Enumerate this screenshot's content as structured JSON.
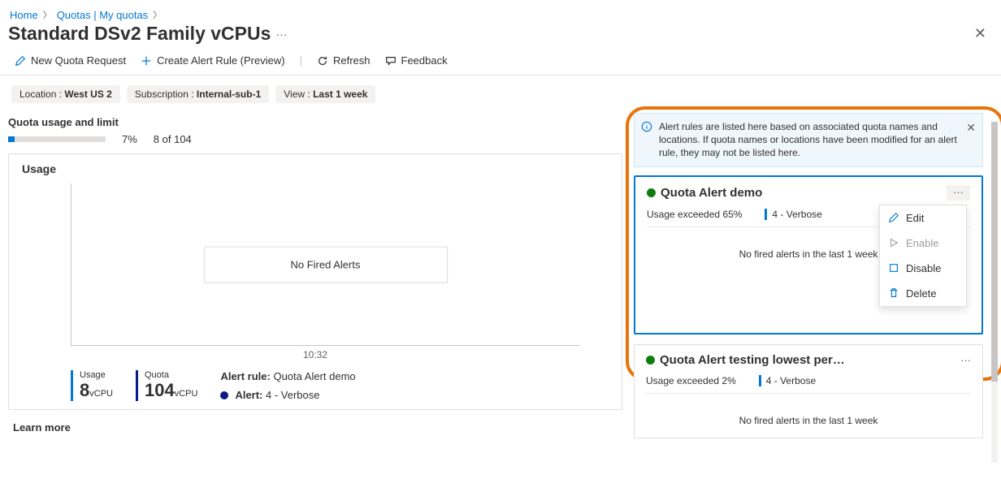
{
  "breadcrumb": {
    "home": "Home",
    "quotas": "Quotas | My quotas"
  },
  "page": {
    "title": "Standard DSv2 Family vCPUs"
  },
  "toolbar": {
    "newRequest": "New Quota Request",
    "createAlert": "Create Alert Rule (Preview)",
    "refresh": "Refresh",
    "feedback": "Feedback"
  },
  "filters": {
    "locLabel": "Location :",
    "locVal": "West US 2",
    "subLabel": "Subscription :",
    "subVal": "Internal-sub-1",
    "viewLabel": "View :",
    "viewVal": "Last 1 week"
  },
  "usage": {
    "section": "Quota usage and limit",
    "pct": "7%",
    "ratio": "8 of 104",
    "card": "Usage",
    "noFired": "No Fired Alerts",
    "xTick": "10:32",
    "usageLabel": "Usage",
    "usageVal": "8",
    "usageUnit": "vCPU",
    "quotaLabel": "Quota",
    "quotaVal": "104",
    "quotaUnit": "vCPU",
    "ruleLabel": "Alert rule:",
    "ruleVal": "Quota Alert demo",
    "alertLabel": "Alert:",
    "alertVal": "4 - Verbose"
  },
  "learn": "Learn more",
  "infoBanner": "Alert rules are listed here based on associated quota names and locations. If quota names or locations have been modified for an alert rule, they may not be listed here.",
  "cards": [
    {
      "title": "Quota Alert demo",
      "cond": "Usage exceeded 65%",
      "sev": "4 - Verbose",
      "fired": "No fired alerts in the last 1 week"
    },
    {
      "title": "Quota Alert testing lowest per…",
      "cond": "Usage exceeded 2%",
      "sev": "4 - Verbose",
      "fired": "No fired alerts in the last 1 week"
    }
  ],
  "menu": {
    "edit": "Edit",
    "enable": "Enable",
    "disable": "Disable",
    "delete": "Delete"
  }
}
